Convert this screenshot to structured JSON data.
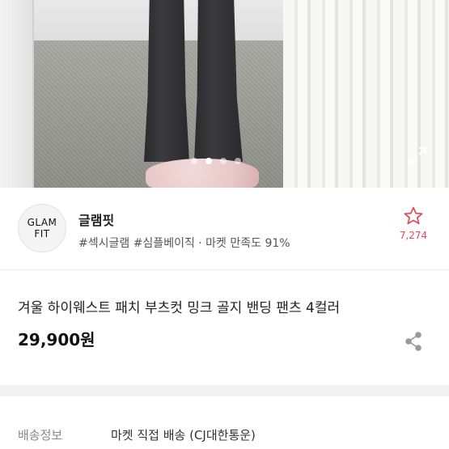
{
  "gallery": {
    "slide_count": 4,
    "active_slide": 2
  },
  "seller": {
    "logo_line1": "GLAM",
    "logo_line2": "FIT",
    "name": "글램핏",
    "tags": "#섹시글램 #심플베이직 · 마켓 만족도 91%",
    "like_count": "7,274",
    "accent_color": "#e24a5c"
  },
  "product": {
    "title": "겨울 하이웨스트 패치 부츠컷 밍크 골지 밴딩 팬츠 4컬러",
    "price": "29,900원"
  },
  "shipping": {
    "label": "배송정보",
    "value": "마켓 직접 배송 (CJ대한통운)"
  },
  "icons": {
    "expand": "expand-icon",
    "star": "star-icon",
    "share": "share-icon"
  }
}
